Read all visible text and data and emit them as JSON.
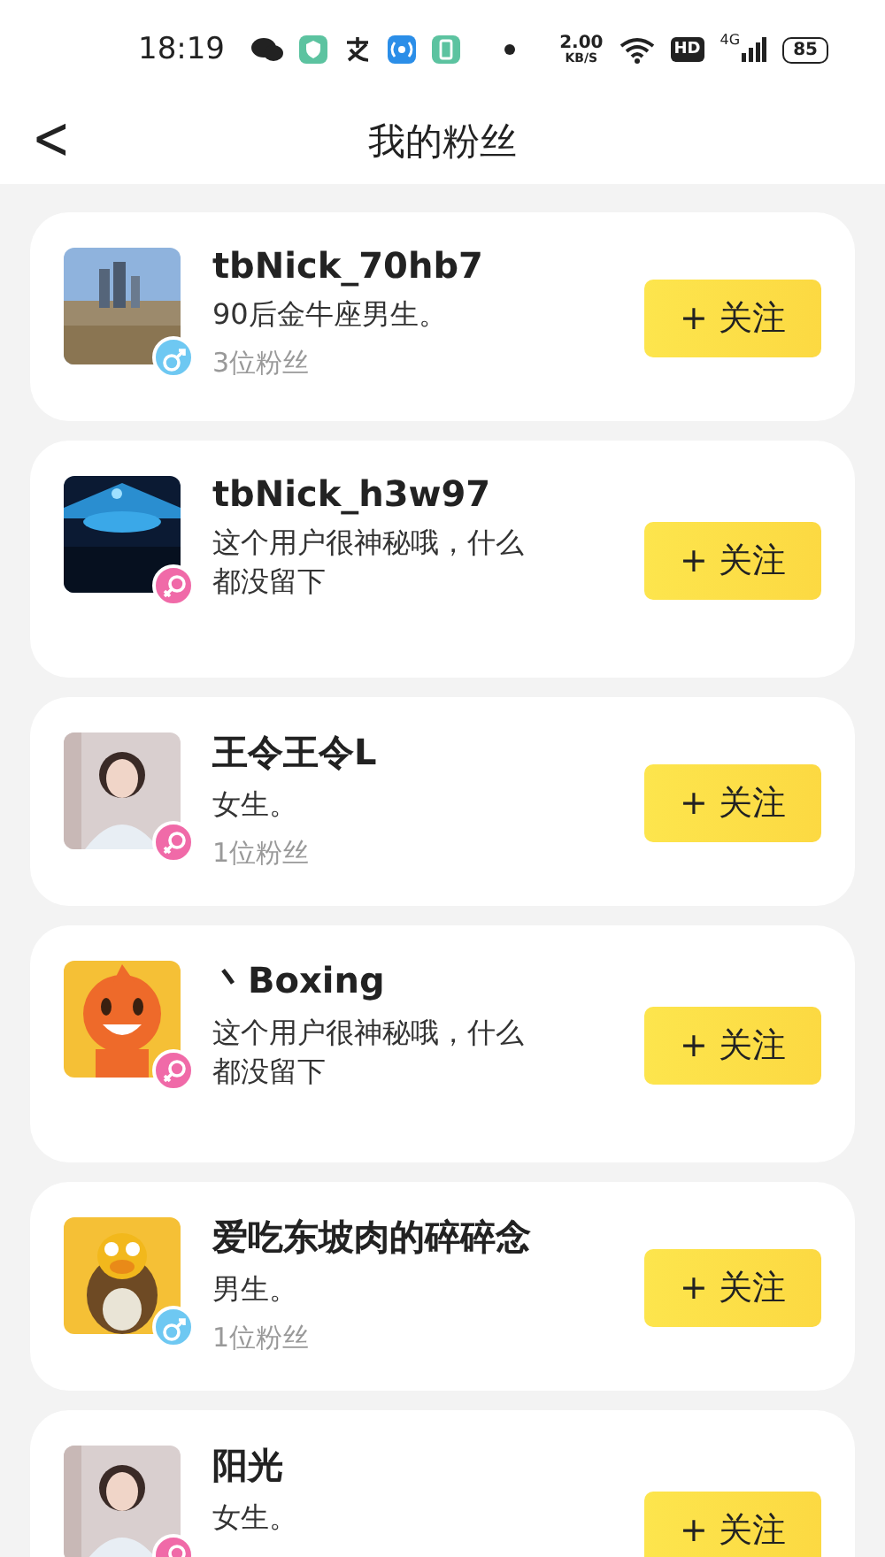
{
  "status_bar": {
    "time": "18:19",
    "speed_value": "2.00",
    "speed_unit": "KB/S",
    "hd": "HD",
    "network": "4G",
    "battery": "85"
  },
  "header": {
    "back": "<",
    "title": "我的粉丝"
  },
  "fans": [
    {
      "name": "tbNick_70hb7",
      "bio": "90后金牛座男生。",
      "fans": "3位粉丝",
      "gender_badge": {
        "kind": "male"
      },
      "follow": "+ 关注"
    },
    {
      "name": "tbNick_h3w97",
      "bio": "这个用户很神秘哦，什么都没留下",
      "gender_badge": {
        "kind": "female"
      },
      "follow": "+ 关注"
    },
    {
      "name": "王令王令L",
      "bio": "女生。",
      "fans": "1位粉丝",
      "gender_badge": {
        "kind": "female"
      },
      "follow": "+ 关注"
    },
    {
      "name": "丶Boxing",
      "bio": "这个用户很神秘哦，什么都没留下",
      "gender_badge": {
        "kind": "female"
      },
      "follow": "+ 关注"
    },
    {
      "name": "爱吃东坡肉的碎碎念",
      "bio": "男生。",
      "fans": "1位粉丝",
      "gender_badge": {
        "kind": "male"
      },
      "follow": "+ 关注"
    },
    {
      "name": "阳光",
      "bio": "女生。",
      "gender_badge": {
        "kind": "female"
      },
      "follow": "+ 关注"
    }
  ]
}
